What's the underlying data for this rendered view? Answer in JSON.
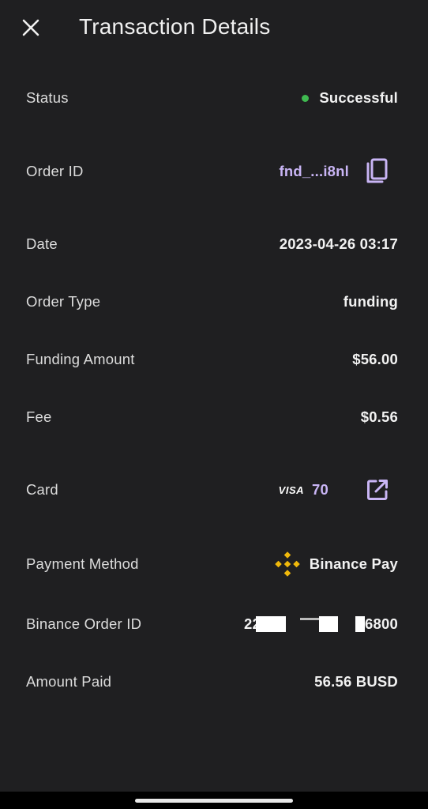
{
  "header": {
    "title": "Transaction Details",
    "close_icon": "close-icon"
  },
  "rows": {
    "status": {
      "label": "Status",
      "value": "Successful",
      "dot_color": "#3fb950"
    },
    "order_id": {
      "label": "Order ID",
      "value": "fnd_...i8nl",
      "icon": "copy-icon"
    },
    "date": {
      "label": "Date",
      "value": "2023-04-26 03:17"
    },
    "order_type": {
      "label": "Order Type",
      "value": "funding"
    },
    "funding_amount": {
      "label": "Funding Amount",
      "value": "$56.00"
    },
    "fee": {
      "label": "Fee",
      "value": "$0.56"
    },
    "card": {
      "label": "Card",
      "brand": "VISA",
      "last_digits": "70",
      "icon": "external-link-icon"
    },
    "payment_method": {
      "label": "Payment Method",
      "value": "Binance Pay",
      "icon": "binance-logo-icon"
    },
    "binance_order_id": {
      "label": "Binance Order ID",
      "prefix": "22",
      "suffix": "6800"
    },
    "amount_paid": {
      "label": "Amount Paid",
      "value": "56.56 BUSD"
    }
  },
  "colors": {
    "background": "#1f1f21",
    "accent": "#c9b5f5",
    "success": "#3fb950",
    "binance": "#f0b90b"
  }
}
